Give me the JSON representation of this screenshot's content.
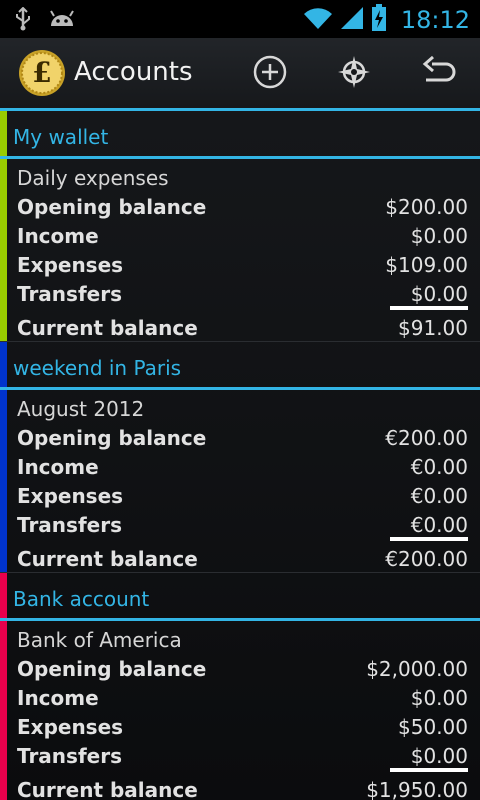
{
  "status_bar": {
    "time": "18:12",
    "icons": [
      "usb-icon",
      "android-icon",
      "wifi-icon",
      "signal-icon",
      "battery-charging-icon"
    ]
  },
  "action_bar": {
    "title": "Accounts",
    "logo_icon": "pound-coin-icon",
    "actions": [
      "add-icon",
      "compass-icon",
      "undo-icon"
    ],
    "accent_color": "#33b5e5"
  },
  "groups": [
    {
      "title": "My wallet",
      "color": "#99cc00",
      "account": "Daily expenses",
      "rows": {
        "opening": {
          "label": "Opening balance",
          "value": "$200.00"
        },
        "income": {
          "label": "Income",
          "value": "$0.00"
        },
        "expenses": {
          "label": "Expenses",
          "value": "$109.00"
        },
        "transfers": {
          "label": "Transfers",
          "value": "$0.00"
        },
        "current": {
          "label": "Current balance",
          "value": "$91.00"
        }
      }
    },
    {
      "title": "weekend in Paris",
      "color": "#0033cc",
      "account": "August 2012",
      "rows": {
        "opening": {
          "label": "Opening balance",
          "value": "€200.00"
        },
        "income": {
          "label": "Income",
          "value": "€0.00"
        },
        "expenses": {
          "label": "Expenses",
          "value": "€0.00"
        },
        "transfers": {
          "label": "Transfers",
          "value": "€0.00"
        },
        "current": {
          "label": "Current balance",
          "value": "€200.00"
        }
      }
    },
    {
      "title": "Bank account",
      "color": "#e8004c",
      "account": "Bank of America",
      "rows": {
        "opening": {
          "label": "Opening balance",
          "value": "$2,000.00"
        },
        "income": {
          "label": "Income",
          "value": "$0.00"
        },
        "expenses": {
          "label": "Expenses",
          "value": "$50.00"
        },
        "transfers": {
          "label": "Transfers",
          "value": "$0.00"
        },
        "current": {
          "label": "Current balance",
          "value": "$1,950.00"
        }
      }
    }
  ]
}
